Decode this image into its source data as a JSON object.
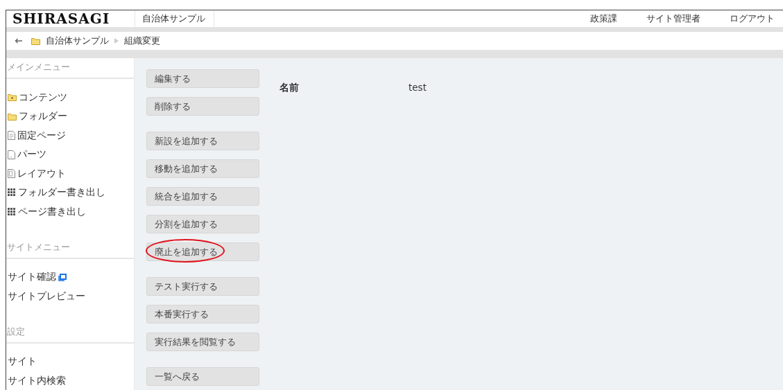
{
  "header": {
    "logo": "SHIRASAGI",
    "site_tab": "自治体サンプル",
    "nav": [
      "政策課",
      "サイト管理者",
      "ログアウト"
    ]
  },
  "breadcrumb": {
    "items": [
      "自治体サンプル",
      "組織変更"
    ]
  },
  "sidebar": {
    "sections": [
      {
        "heading": "メインメニュー",
        "items": [
          {
            "label": "コンテンツ",
            "kind": "folder_plus"
          },
          {
            "label": "フォルダー",
            "kind": "folder"
          },
          {
            "label": "固定ページ",
            "kind": "page"
          },
          {
            "label": "パーツ",
            "kind": "part"
          },
          {
            "label": "レイアウト",
            "kind": "layout"
          },
          {
            "label": "フォルダー書き出し",
            "kind": "grid"
          },
          {
            "label": "ページ書き出し",
            "kind": "grid"
          }
        ]
      },
      {
        "heading": "サイトメニュー",
        "items": [
          {
            "label": "サイト確認",
            "kind": "external"
          },
          {
            "label": "サイトプレビュー",
            "kind": "plain"
          }
        ]
      },
      {
        "heading": "設定",
        "items": [
          {
            "label": "サイト",
            "kind": "plain"
          },
          {
            "label": "サイト内検索",
            "kind": "plain"
          }
        ]
      }
    ]
  },
  "actions": [
    [
      {
        "label": "編集する",
        "highlighted": false
      },
      {
        "label": "削除する",
        "highlighted": false
      }
    ],
    [
      {
        "label": "新設を追加する",
        "highlighted": false
      },
      {
        "label": "移動を追加する",
        "highlighted": false
      },
      {
        "label": "統合を追加する",
        "highlighted": false
      },
      {
        "label": "分割を追加する",
        "highlighted": false
      },
      {
        "label": "廃止を追加する",
        "highlighted": true
      }
    ],
    [
      {
        "label": "テスト実行する",
        "highlighted": false
      },
      {
        "label": "本番実行する",
        "highlighted": false
      },
      {
        "label": "実行結果を閲覧する",
        "highlighted": false
      }
    ],
    [
      {
        "label": "一覧へ戻る",
        "highlighted": false
      }
    ]
  ],
  "details": [
    {
      "label": "名前",
      "value": "test"
    }
  ]
}
